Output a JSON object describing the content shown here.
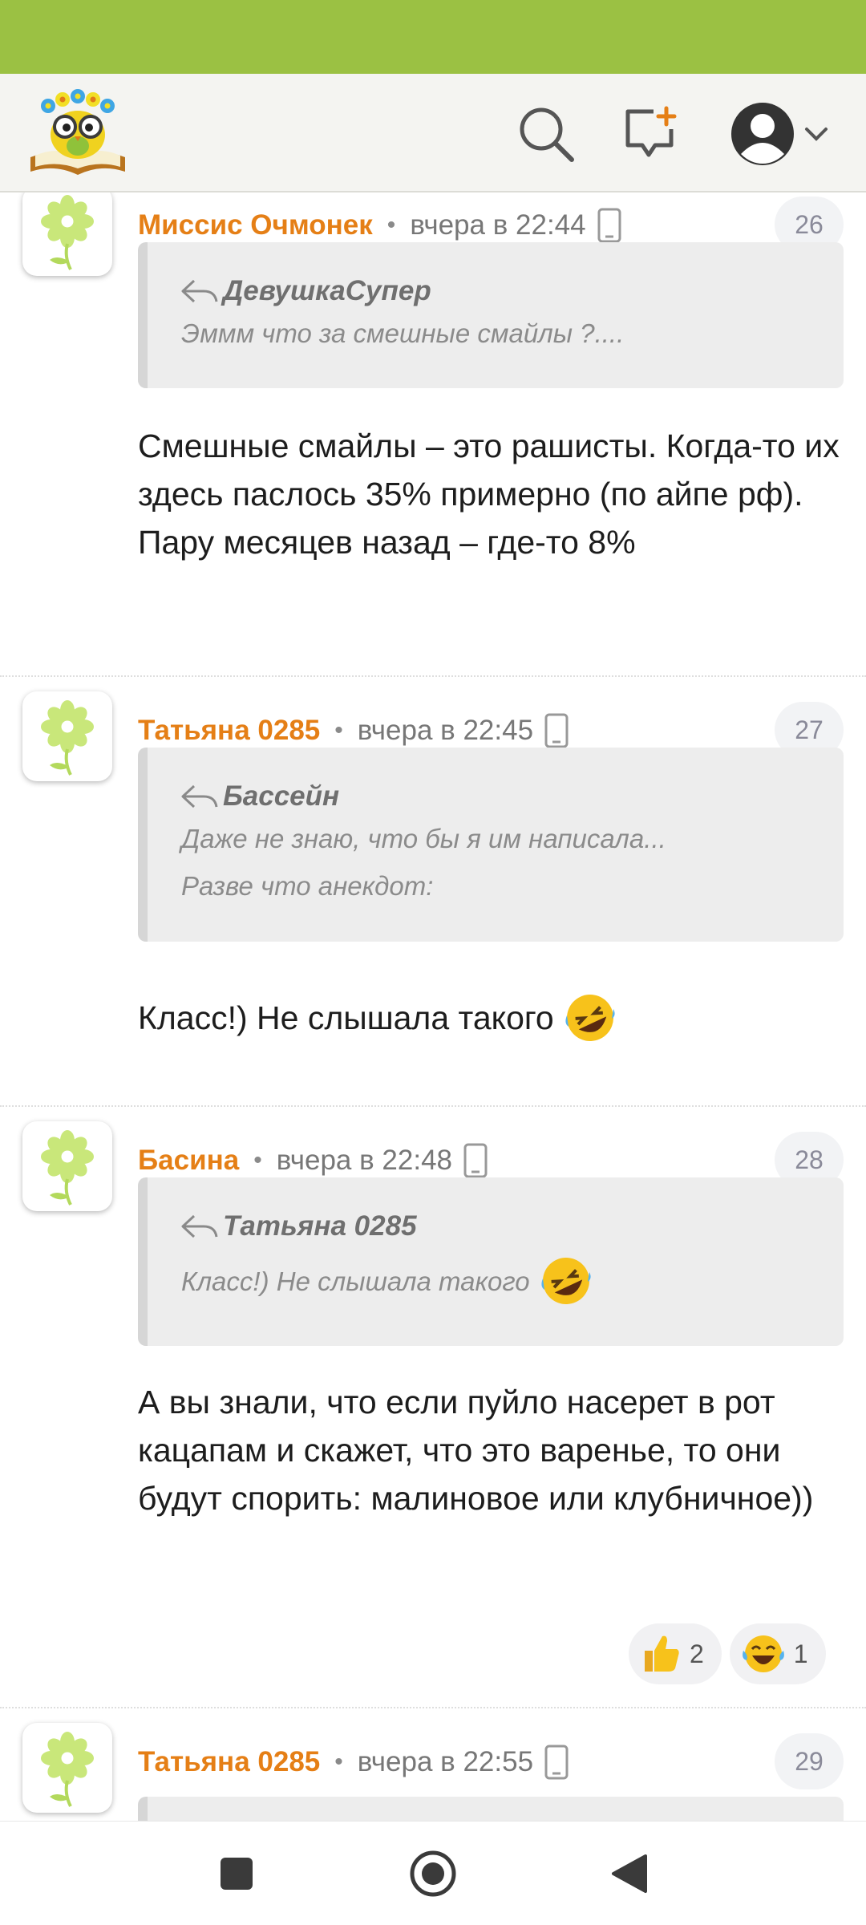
{
  "header": {
    "logo_icon": "owl-with-flowers-on-book-logo",
    "search_icon": "search-icon",
    "new_message_icon": "add-comment-icon",
    "profile_icon": "user-avatar-icon"
  },
  "colors": {
    "status_bar": "#9bc143",
    "author": "#e57f16",
    "quote_bg": "#ededed"
  },
  "comments": [
    {
      "author": "Миссис Очмонек",
      "time": "вчера в 22:44",
      "number": "26",
      "quote_author": "ДевушкаСупер",
      "quote_lines": [
        "Эммм что за смешные смайлы ?...."
      ],
      "text": "Смешные смайлы – это рашисты. Когда-то их здесь паслось 35% примерно (по айпе рф). Пару месяцев назад – где-то 8%"
    },
    {
      "author": "Татьяна 0285",
      "time": "вчера в 22:45",
      "number": "27",
      "quote_author": "Бассейн",
      "quote_lines": [
        "Даже не знаю, что бы я им написала...",
        "Разве что анекдот:"
      ],
      "text": "Класс!) Не слышала такого"
    },
    {
      "author": "Басина",
      "time": "вчера в 22:48",
      "number": "28",
      "quote_author": "Татьяна 0285",
      "quote_lines": [
        "Класс!) Не слышала такого"
      ],
      "text": "А вы знали, что если пуйло насерет в рот кацапам и скажет, что это варенье, то они будут спорить: малиновое или клубничное))",
      "reactions": [
        {
          "icon": "thumbs-up-emoji",
          "count": "2"
        },
        {
          "icon": "laughing-tears-emoji",
          "count": "1"
        }
      ]
    },
    {
      "author": "Татьяна 0285",
      "time": "вчера в 22:55",
      "number": "29"
    }
  ]
}
